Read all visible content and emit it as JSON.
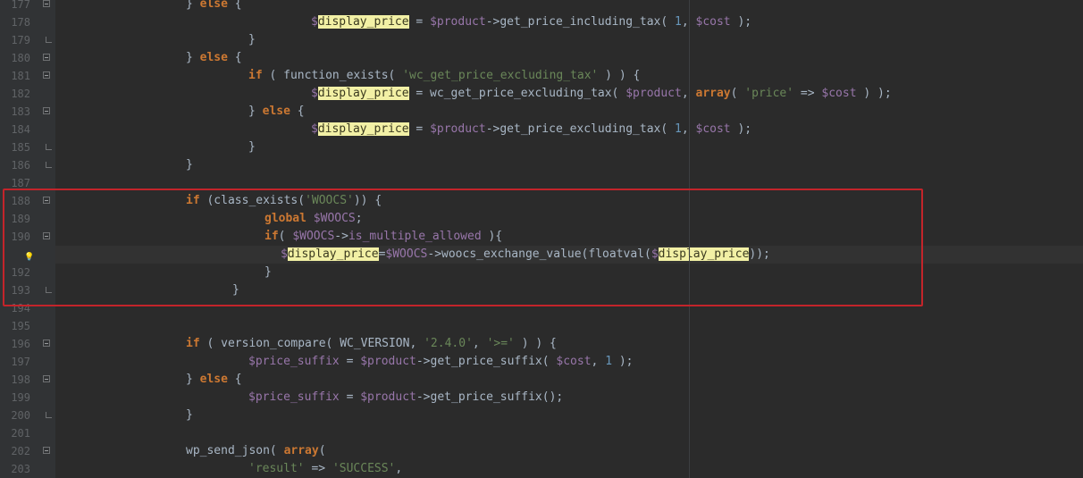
{
  "editor": {
    "lines": [
      {
        "n": "177",
        "fold": "box",
        "indent": 208,
        "tokens": [
          [
            "}",
            ""
          ],
          [
            " ",
            ""
          ],
          [
            "else",
            "kw"
          ],
          [
            " {",
            ""
          ]
        ]
      },
      {
        "n": "178",
        "fold": "line",
        "indent": 348,
        "tokens": [
          [
            "$",
            "var"
          ],
          [
            "display_price",
            "hl"
          ],
          [
            " = ",
            ""
          ],
          [
            "$product",
            "var"
          ],
          [
            "->get_price_including_tax( ",
            ""
          ],
          [
            "1",
            "num"
          ],
          [
            ", ",
            ""
          ],
          [
            "$cost",
            "var"
          ],
          [
            " );",
            ""
          ]
        ]
      },
      {
        "n": "179",
        "fold": "end",
        "indent": 278,
        "tokens": [
          [
            "}",
            ""
          ]
        ]
      },
      {
        "n": "180",
        "fold": "box",
        "indent": 208,
        "tokens": [
          [
            "} ",
            ""
          ],
          [
            "else",
            "kw"
          ],
          [
            " {",
            ""
          ]
        ]
      },
      {
        "n": "181",
        "fold": "box",
        "indent": 278,
        "tokens": [
          [
            "if",
            "kw"
          ],
          [
            " ( function_exists( ",
            ""
          ],
          [
            "'wc_get_price_excluding_tax'",
            "str"
          ],
          [
            " ) ) {",
            ""
          ]
        ]
      },
      {
        "n": "182",
        "fold": "line",
        "indent": 348,
        "tokens": [
          [
            "$",
            "var"
          ],
          [
            "display_price",
            "hl"
          ],
          [
            " = wc_get_price_excluding_tax( ",
            ""
          ],
          [
            "$product",
            "var"
          ],
          [
            ", ",
            ""
          ],
          [
            "array",
            "kw"
          ],
          [
            "( ",
            ""
          ],
          [
            "'price'",
            "str"
          ],
          [
            " => ",
            ""
          ],
          [
            "$cost",
            "var"
          ],
          [
            " ) );",
            ""
          ]
        ]
      },
      {
        "n": "183",
        "fold": "box",
        "indent": 278,
        "tokens": [
          [
            "} ",
            ""
          ],
          [
            "else",
            "kw"
          ],
          [
            " {",
            ""
          ]
        ]
      },
      {
        "n": "184",
        "fold": "line",
        "indent": 348,
        "tokens": [
          [
            "$",
            "var"
          ],
          [
            "display_price",
            "hl"
          ],
          [
            " = ",
            ""
          ],
          [
            "$product",
            "var"
          ],
          [
            "->get_price_excluding_tax( ",
            ""
          ],
          [
            "1",
            "num"
          ],
          [
            ", ",
            ""
          ],
          [
            "$cost",
            "var"
          ],
          [
            " );",
            ""
          ]
        ]
      },
      {
        "n": "185",
        "fold": "end",
        "indent": 278,
        "tokens": [
          [
            "}",
            ""
          ]
        ]
      },
      {
        "n": "186",
        "fold": "end",
        "indent": 208,
        "tokens": [
          [
            "}",
            ""
          ]
        ]
      },
      {
        "n": "187",
        "fold": "",
        "indent": 208,
        "tokens": []
      },
      {
        "n": "188",
        "fold": "box",
        "indent": 208,
        "tokens": [
          [
            "if",
            "kw"
          ],
          [
            " (class_exists(",
            ""
          ],
          [
            "'WOOCS'",
            "str"
          ],
          [
            ")) {",
            ""
          ]
        ]
      },
      {
        "n": "189",
        "fold": "line",
        "indent": 296,
        "tokens": [
          [
            "global",
            "kw"
          ],
          [
            " ",
            ""
          ],
          [
            "$WOOCS",
            "var"
          ],
          [
            ";",
            ""
          ]
        ]
      },
      {
        "n": "190",
        "fold": "box",
        "indent": 296,
        "tokens": [
          [
            "if",
            "kw"
          ],
          [
            "( ",
            ""
          ],
          [
            "$WOOCS",
            "var"
          ],
          [
            "->",
            ""
          ],
          [
            "is_multiple_allowed",
            "var"
          ],
          [
            " ){",
            ""
          ]
        ]
      },
      {
        "n": "",
        "fold": "bulb",
        "caret": true,
        "indent": 314,
        "tokens": [
          [
            "$",
            "var"
          ],
          [
            "display_price",
            "hl"
          ],
          [
            "=",
            ""
          ],
          [
            "$WOOCS",
            "var"
          ],
          [
            "->woocs_exchange_value(floatval(",
            ""
          ],
          [
            "$",
            "var"
          ],
          [
            "display_price",
            "hl"
          ],
          [
            "));",
            ""
          ]
        ]
      },
      {
        "n": "192",
        "fold": "line",
        "indent": 296,
        "tokens": [
          [
            "}",
            ""
          ]
        ]
      },
      {
        "n": "193",
        "fold": "end",
        "indent": 260,
        "tokens": [
          [
            "}",
            ""
          ]
        ]
      },
      {
        "n": "194",
        "fold": "",
        "indent": 208,
        "tokens": []
      },
      {
        "n": "195",
        "fold": "",
        "indent": 208,
        "tokens": []
      },
      {
        "n": "196",
        "fold": "box",
        "indent": 208,
        "tokens": [
          [
            "if",
            "kw"
          ],
          [
            " ( version_compare( WC_VERSION, ",
            ""
          ],
          [
            "'2.4.0'",
            "str"
          ],
          [
            ", ",
            ""
          ],
          [
            "'>='",
            "str"
          ],
          [
            " ) ) {",
            ""
          ]
        ]
      },
      {
        "n": "197",
        "fold": "line",
        "indent": 278,
        "tokens": [
          [
            "$price_suffix",
            "var"
          ],
          [
            " = ",
            ""
          ],
          [
            "$product",
            "var"
          ],
          [
            "->get_price_suffix( ",
            ""
          ],
          [
            "$cost",
            "var"
          ],
          [
            ", ",
            ""
          ],
          [
            "1",
            "num"
          ],
          [
            " );",
            ""
          ]
        ]
      },
      {
        "n": "198",
        "fold": "box",
        "indent": 208,
        "tokens": [
          [
            "} ",
            ""
          ],
          [
            "else",
            "kw"
          ],
          [
            " {",
            ""
          ]
        ]
      },
      {
        "n": "199",
        "fold": "line",
        "indent": 278,
        "tokens": [
          [
            "$price_suffix",
            "var"
          ],
          [
            " = ",
            ""
          ],
          [
            "$product",
            "var"
          ],
          [
            "->get_price_suffix();",
            ""
          ]
        ]
      },
      {
        "n": "200",
        "fold": "end",
        "indent": 208,
        "tokens": [
          [
            "}",
            ""
          ]
        ]
      },
      {
        "n": "201",
        "fold": "",
        "indent": 208,
        "tokens": []
      },
      {
        "n": "202",
        "fold": "box",
        "indent": 208,
        "tokens": [
          [
            "wp_send_json( ",
            ""
          ],
          [
            "array",
            "kw"
          ],
          [
            "(",
            ""
          ]
        ]
      },
      {
        "n": "203",
        "fold": "line",
        "indent": 278,
        "tokens": [
          [
            "'result'",
            "str"
          ],
          [
            " => ",
            ""
          ],
          [
            "'SUCCESS'",
            "str"
          ],
          [
            ",",
            ""
          ]
        ]
      }
    ]
  },
  "colors": {
    "background": "#2b2b2b",
    "gutter": "#313335",
    "keyword": "#cc7832",
    "variable": "#9876aa",
    "string": "#6a8759",
    "number": "#6897bb",
    "default_text": "#a9b7c6",
    "search_highlight": "#f2f0a5",
    "annotation_box": "#c3242a"
  },
  "icons": {
    "fold_open": "fold-toggle-icon",
    "fold_end": "fold-end-icon",
    "intention": "lightbulb-icon"
  }
}
